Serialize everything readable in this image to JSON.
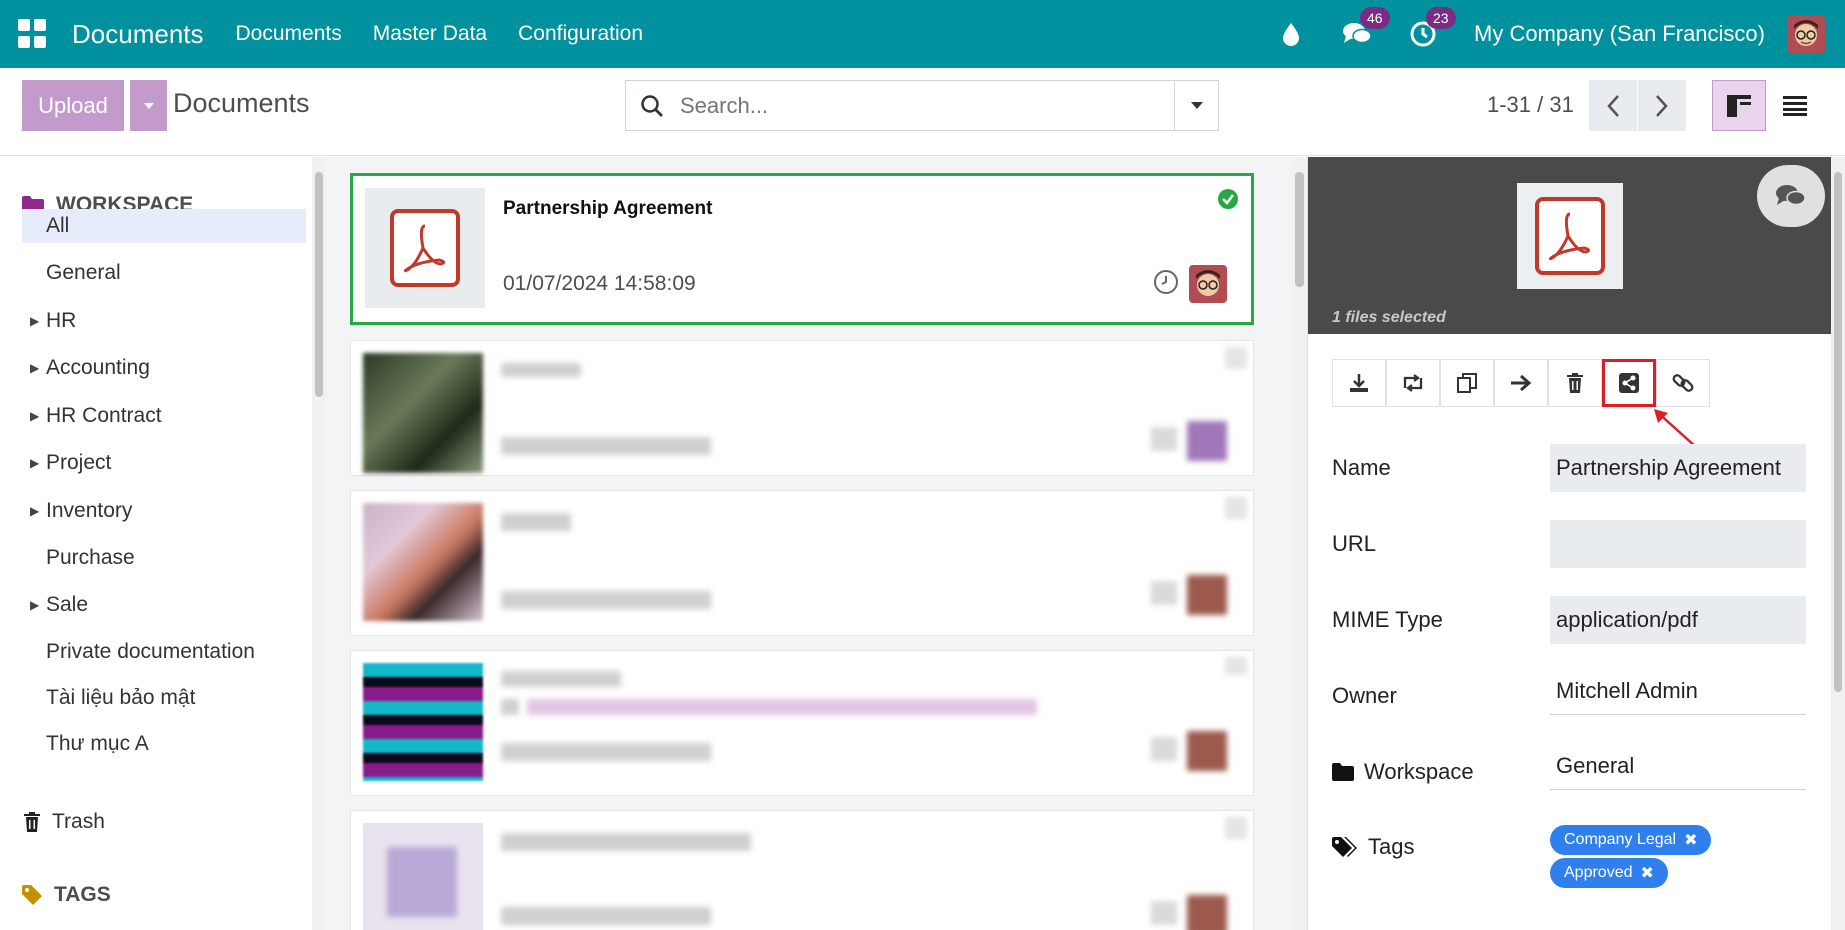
{
  "nav": {
    "app_title": "Documents",
    "links": [
      "Documents",
      "Master Data",
      "Configuration"
    ],
    "chat_badge": "46",
    "activity_badge": "23",
    "company": "My Company (San Francisco)"
  },
  "control": {
    "upload_label": "Upload",
    "title": "Documents",
    "search_placeholder": "Search...",
    "pager": "1-31 / 31"
  },
  "sidebar": {
    "workspace_header": "WORKSPACE",
    "items": [
      {
        "label": "All",
        "caret": false,
        "active": true
      },
      {
        "label": "General",
        "caret": false
      },
      {
        "label": "HR",
        "caret": true
      },
      {
        "label": "Accounting",
        "caret": true
      },
      {
        "label": "HR Contract",
        "caret": true
      },
      {
        "label": "Project",
        "caret": true
      },
      {
        "label": "Inventory",
        "caret": true
      },
      {
        "label": "Purchase",
        "caret": false
      },
      {
        "label": "Sale",
        "caret": true
      },
      {
        "label": "Private documentation",
        "caret": false
      },
      {
        "label": "Tài liệu bảo mật",
        "caret": false
      },
      {
        "label": "Thư mục A",
        "caret": false
      }
    ],
    "trash_label": "Trash",
    "tags_header": "TAGS"
  },
  "kanban": {
    "selected_card": {
      "title": "Partnership Agreement",
      "date": "01/07/2024 14:58:09"
    }
  },
  "inspector": {
    "files_selected": "1 files selected",
    "fields": {
      "name_label": "Name",
      "name_value": "Partnership Agreement",
      "url_label": "URL",
      "url_value": "",
      "mime_label": "MIME Type",
      "mime_value": "application/pdf",
      "owner_label": "Owner",
      "owner_value": "Mitchell Admin",
      "workspace_label": "Workspace",
      "workspace_value": "General",
      "tags_label": "Tags"
    },
    "tags": [
      "Company Legal",
      "Approved"
    ]
  },
  "colors": {
    "topbar": "#00919e",
    "upload": "#c39acc",
    "selected_border": "#28a745",
    "tag": "#2f80ed",
    "highlight": "#e01b24"
  }
}
